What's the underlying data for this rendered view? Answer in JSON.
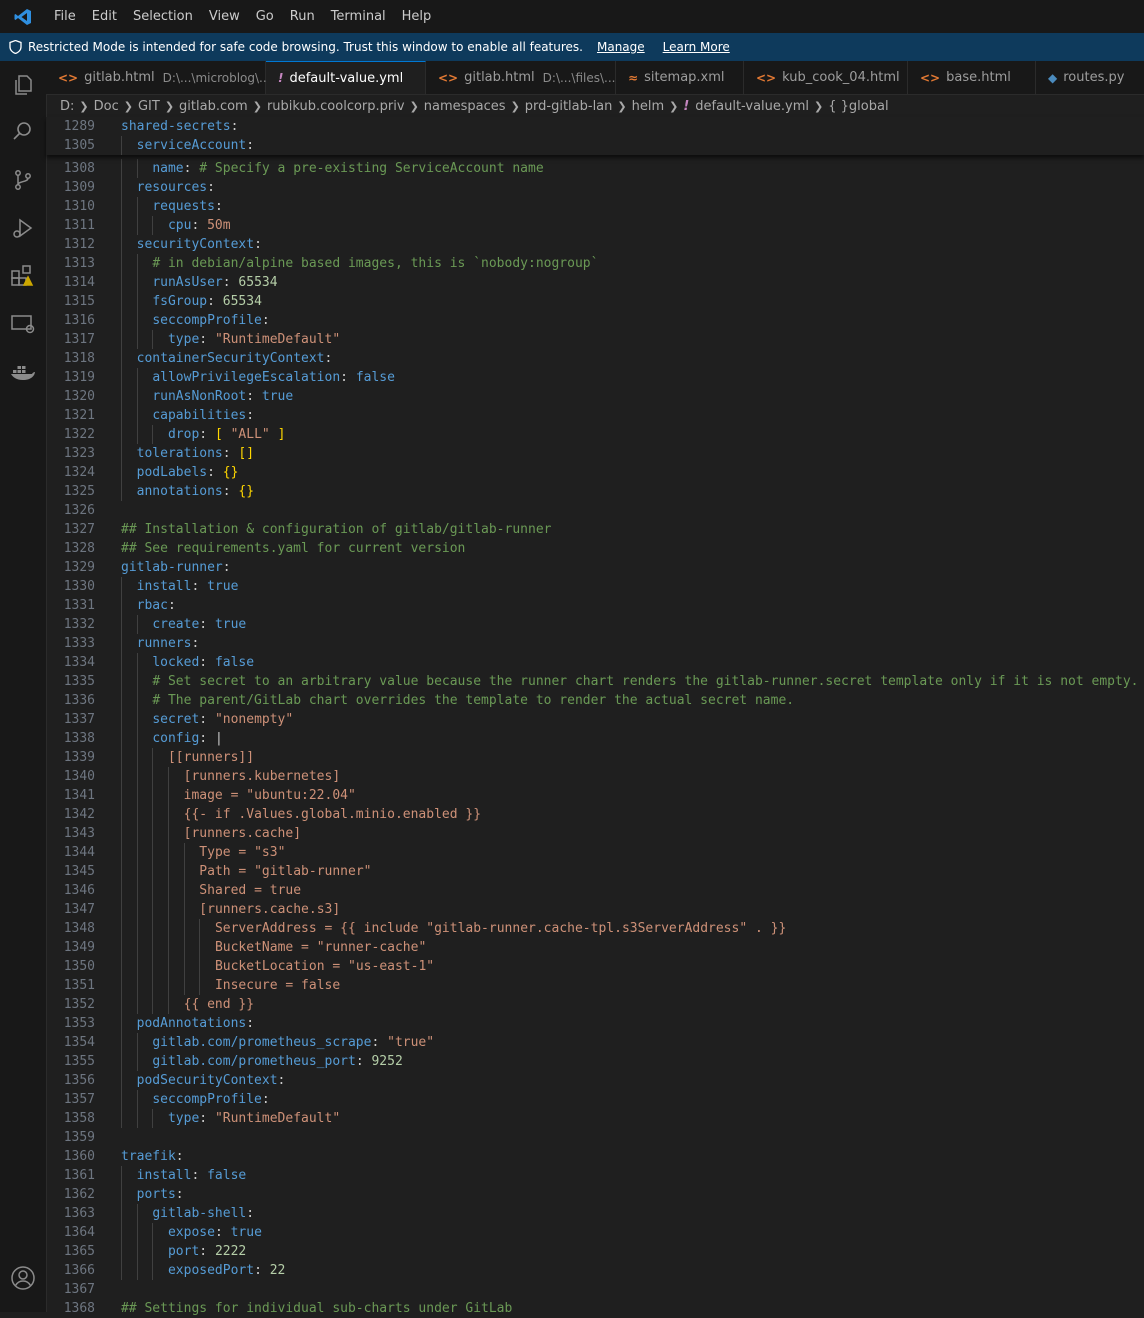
{
  "menu": [
    "File",
    "Edit",
    "Selection",
    "View",
    "Go",
    "Run",
    "Terminal",
    "Help"
  ],
  "banner": {
    "text": "Restricted Mode is intended for safe code browsing. Trust this window to enable all features.",
    "manage": "Manage",
    "learn_more": "Learn More"
  },
  "tabs": [
    {
      "label": "gitlab.html",
      "desc": "D:\\...\\microblog\\...",
      "type": "html",
      "active": false
    },
    {
      "label": "default-value.yml",
      "desc": "",
      "type": "yml",
      "active": true
    },
    {
      "label": "gitlab.html",
      "desc": "D:\\...\\files\\...",
      "type": "html",
      "active": false
    },
    {
      "label": "sitemap.xml",
      "desc": "",
      "type": "xml",
      "active": false
    },
    {
      "label": "kub_cook_04.html",
      "desc": "",
      "type": "html",
      "active": false
    },
    {
      "label": "base.html",
      "desc": "",
      "type": "html",
      "active": false
    },
    {
      "label": "routes.py",
      "desc": "",
      "type": "py",
      "active": false
    }
  ],
  "breadcrumb": [
    "D:",
    "Doc",
    "GIT",
    "gitlab.com",
    "rubikub.coolcorp.priv",
    "namespaces",
    "prd-gitlab-lan",
    "helm",
    "default-value.yml",
    "global"
  ],
  "sticky_lines": [
    {
      "n": "1289",
      "indent": 0,
      "t": [
        [
          "k",
          "shared-secrets"
        ],
        [
          "p",
          ":"
        ]
      ]
    },
    {
      "n": "1305",
      "indent": 2,
      "t": [
        [
          "k",
          "serviceAccount"
        ],
        [
          "p",
          ":"
        ]
      ]
    }
  ],
  "lines": [
    {
      "n": "1308",
      "indent": 4,
      "t": [
        [
          "k",
          "name"
        ],
        [
          "p",
          ": "
        ],
        [
          "c",
          "# Specify a pre-existing ServiceAccount name"
        ]
      ]
    },
    {
      "n": "1309",
      "indent": 2,
      "t": [
        [
          "k",
          "resources"
        ],
        [
          "p",
          ":"
        ]
      ]
    },
    {
      "n": "1310",
      "indent": 4,
      "t": [
        [
          "k",
          "requests"
        ],
        [
          "p",
          ":"
        ]
      ]
    },
    {
      "n": "1311",
      "indent": 6,
      "t": [
        [
          "k",
          "cpu"
        ],
        [
          "p",
          ": "
        ],
        [
          "s",
          "50m"
        ]
      ]
    },
    {
      "n": "1312",
      "indent": 2,
      "t": [
        [
          "k",
          "securityContext"
        ],
        [
          "p",
          ":"
        ]
      ]
    },
    {
      "n": "1313",
      "indent": 4,
      "t": [
        [
          "c",
          "# in debian/alpine based images, this is `nobody:nogroup`"
        ]
      ]
    },
    {
      "n": "1314",
      "indent": 4,
      "t": [
        [
          "k",
          "runAsUser"
        ],
        [
          "p",
          ": "
        ],
        [
          "n",
          "65534"
        ]
      ]
    },
    {
      "n": "1315",
      "indent": 4,
      "t": [
        [
          "k",
          "fsGroup"
        ],
        [
          "p",
          ": "
        ],
        [
          "n",
          "65534"
        ]
      ]
    },
    {
      "n": "1316",
      "indent": 4,
      "t": [
        [
          "k",
          "seccompProfile"
        ],
        [
          "p",
          ":"
        ]
      ]
    },
    {
      "n": "1317",
      "indent": 6,
      "t": [
        [
          "k",
          "type"
        ],
        [
          "p",
          ": "
        ],
        [
          "s",
          "\"RuntimeDefault\""
        ]
      ]
    },
    {
      "n": "1318",
      "indent": 2,
      "t": [
        [
          "k",
          "containerSecurityContext"
        ],
        [
          "p",
          ":"
        ]
      ]
    },
    {
      "n": "1319",
      "indent": 4,
      "t": [
        [
          "k",
          "allowPrivilegeEscalation"
        ],
        [
          "p",
          ": "
        ],
        [
          "b",
          "false"
        ]
      ]
    },
    {
      "n": "1320",
      "indent": 4,
      "t": [
        [
          "k",
          "runAsNonRoot"
        ],
        [
          "p",
          ": "
        ],
        [
          "b",
          "true"
        ]
      ]
    },
    {
      "n": "1321",
      "indent": 4,
      "t": [
        [
          "k",
          "capabilities"
        ],
        [
          "p",
          ":"
        ]
      ]
    },
    {
      "n": "1322",
      "indent": 6,
      "t": [
        [
          "k",
          "drop"
        ],
        [
          "p",
          ": "
        ],
        [
          "y",
          "["
        ],
        [
          "p",
          " "
        ],
        [
          "s",
          "\"ALL\""
        ],
        [
          "p",
          " "
        ],
        [
          "y",
          "]"
        ]
      ]
    },
    {
      "n": "1323",
      "indent": 2,
      "t": [
        [
          "k",
          "tolerations"
        ],
        [
          "p",
          ": "
        ],
        [
          "y",
          "[]"
        ]
      ]
    },
    {
      "n": "1324",
      "indent": 2,
      "t": [
        [
          "k",
          "podLabels"
        ],
        [
          "p",
          ": "
        ],
        [
          "y",
          "{}"
        ]
      ]
    },
    {
      "n": "1325",
      "indent": 2,
      "t": [
        [
          "k",
          "annotations"
        ],
        [
          "p",
          ": "
        ],
        [
          "y",
          "{}"
        ]
      ]
    },
    {
      "n": "1326",
      "indent": 0,
      "t": []
    },
    {
      "n": "1327",
      "indent": 0,
      "t": [
        [
          "c",
          "## Installation & configuration of gitlab/gitlab-runner"
        ]
      ]
    },
    {
      "n": "1328",
      "indent": 0,
      "t": [
        [
          "c",
          "## See requirements.yaml for current version"
        ]
      ]
    },
    {
      "n": "1329",
      "indent": 0,
      "t": [
        [
          "k",
          "gitlab-runner"
        ],
        [
          "p",
          ":"
        ]
      ]
    },
    {
      "n": "1330",
      "indent": 2,
      "t": [
        [
          "k",
          "install"
        ],
        [
          "p",
          ": "
        ],
        [
          "b",
          "true"
        ]
      ]
    },
    {
      "n": "1331",
      "indent": 2,
      "t": [
        [
          "k",
          "rbac"
        ],
        [
          "p",
          ":"
        ]
      ]
    },
    {
      "n": "1332",
      "indent": 4,
      "t": [
        [
          "k",
          "create"
        ],
        [
          "p",
          ": "
        ],
        [
          "b",
          "true"
        ]
      ]
    },
    {
      "n": "1333",
      "indent": 2,
      "t": [
        [
          "k",
          "runners"
        ],
        [
          "p",
          ":"
        ]
      ]
    },
    {
      "n": "1334",
      "indent": 4,
      "t": [
        [
          "k",
          "locked"
        ],
        [
          "p",
          ": "
        ],
        [
          "b",
          "false"
        ]
      ]
    },
    {
      "n": "1335",
      "indent": 4,
      "t": [
        [
          "c",
          "# Set secret to an arbitrary value because the runner chart renders the gitlab-runner.secret template only if it is not empty."
        ]
      ]
    },
    {
      "n": "1336",
      "indent": 4,
      "t": [
        [
          "c",
          "# The parent/GitLab chart overrides the template to render the actual secret name."
        ]
      ]
    },
    {
      "n": "1337",
      "indent": 4,
      "t": [
        [
          "k",
          "secret"
        ],
        [
          "p",
          ": "
        ],
        [
          "s",
          "\"nonempty\""
        ]
      ]
    },
    {
      "n": "1338",
      "indent": 4,
      "t": [
        [
          "k",
          "config"
        ],
        [
          "p",
          ": "
        ],
        [
          "p",
          "|"
        ]
      ]
    },
    {
      "n": "1339",
      "indent": 6,
      "t": [
        [
          "s",
          "[[runners]]"
        ]
      ]
    },
    {
      "n": "1340",
      "indent": 8,
      "t": [
        [
          "s",
          "[runners.kubernetes]"
        ]
      ]
    },
    {
      "n": "1341",
      "indent": 8,
      "t": [
        [
          "s",
          "image = \"ubuntu:22.04\""
        ]
      ]
    },
    {
      "n": "1342",
      "indent": 8,
      "t": [
        [
          "s",
          "{{- if .Values.global.minio.enabled }}"
        ]
      ]
    },
    {
      "n": "1343",
      "indent": 8,
      "t": [
        [
          "s",
          "[runners.cache]"
        ]
      ]
    },
    {
      "n": "1344",
      "indent": 10,
      "t": [
        [
          "s",
          "Type = \"s3\""
        ]
      ]
    },
    {
      "n": "1345",
      "indent": 10,
      "t": [
        [
          "s",
          "Path = \"gitlab-runner\""
        ]
      ]
    },
    {
      "n": "1346",
      "indent": 10,
      "t": [
        [
          "s",
          "Shared = true"
        ]
      ]
    },
    {
      "n": "1347",
      "indent": 10,
      "t": [
        [
          "s",
          "[runners.cache.s3]"
        ]
      ]
    },
    {
      "n": "1348",
      "indent": 12,
      "t": [
        [
          "s",
          "ServerAddress = {{ include \"gitlab-runner.cache-tpl.s3ServerAddress\" . }}"
        ]
      ]
    },
    {
      "n": "1349",
      "indent": 12,
      "t": [
        [
          "s",
          "BucketName = \"runner-cache\""
        ]
      ]
    },
    {
      "n": "1350",
      "indent": 12,
      "t": [
        [
          "s",
          "BucketLocation = \"us-east-1\""
        ]
      ]
    },
    {
      "n": "1351",
      "indent": 12,
      "t": [
        [
          "s",
          "Insecure = false"
        ]
      ]
    },
    {
      "n": "1352",
      "indent": 8,
      "t": [
        [
          "s",
          "{{ end }}"
        ]
      ]
    },
    {
      "n": "1353",
      "indent": 2,
      "t": [
        [
          "k",
          "podAnnotations"
        ],
        [
          "p",
          ":"
        ]
      ]
    },
    {
      "n": "1354",
      "indent": 4,
      "t": [
        [
          "k",
          "gitlab.com/prometheus_scrape"
        ],
        [
          "p",
          ": "
        ],
        [
          "s",
          "\"true\""
        ]
      ]
    },
    {
      "n": "1355",
      "indent": 4,
      "t": [
        [
          "k",
          "gitlab.com/prometheus_port"
        ],
        [
          "p",
          ": "
        ],
        [
          "n",
          "9252"
        ]
      ]
    },
    {
      "n": "1356",
      "indent": 2,
      "t": [
        [
          "k",
          "podSecurityContext"
        ],
        [
          "p",
          ":"
        ]
      ]
    },
    {
      "n": "1357",
      "indent": 4,
      "t": [
        [
          "k",
          "seccompProfile"
        ],
        [
          "p",
          ":"
        ]
      ]
    },
    {
      "n": "1358",
      "indent": 6,
      "t": [
        [
          "k",
          "type"
        ],
        [
          "p",
          ": "
        ],
        [
          "s",
          "\"RuntimeDefault\""
        ]
      ]
    },
    {
      "n": "1359",
      "indent": 0,
      "t": []
    },
    {
      "n": "1360",
      "indent": 0,
      "t": [
        [
          "k",
          "traefik"
        ],
        [
          "p",
          ":"
        ]
      ]
    },
    {
      "n": "1361",
      "indent": 2,
      "t": [
        [
          "k",
          "install"
        ],
        [
          "p",
          ": "
        ],
        [
          "b",
          "false"
        ]
      ]
    },
    {
      "n": "1362",
      "indent": 2,
      "t": [
        [
          "k",
          "ports"
        ],
        [
          "p",
          ":"
        ]
      ]
    },
    {
      "n": "1363",
      "indent": 4,
      "t": [
        [
          "k",
          "gitlab-shell"
        ],
        [
          "p",
          ":"
        ]
      ]
    },
    {
      "n": "1364",
      "indent": 6,
      "t": [
        [
          "k",
          "expose"
        ],
        [
          "p",
          ": "
        ],
        [
          "b",
          "true"
        ]
      ]
    },
    {
      "n": "1365",
      "indent": 6,
      "t": [
        [
          "k",
          "port"
        ],
        [
          "p",
          ": "
        ],
        [
          "n",
          "2222"
        ]
      ]
    },
    {
      "n": "1366",
      "indent": 6,
      "t": [
        [
          "k",
          "exposedPort"
        ],
        [
          "p",
          ": "
        ],
        [
          "n",
          "22"
        ]
      ]
    },
    {
      "n": "1367",
      "indent": 0,
      "t": []
    },
    {
      "n": "1368",
      "indent": 0,
      "t": [
        [
          "c",
          "## Settings for individual sub-charts under GitLab"
        ]
      ]
    }
  ]
}
